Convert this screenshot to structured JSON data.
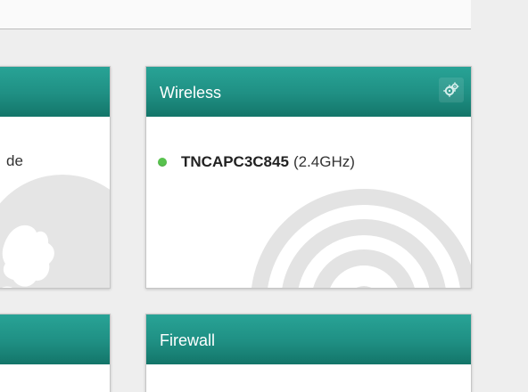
{
  "left_cards": {
    "top_partial_text": "de"
  },
  "wireless": {
    "title": "Wireless",
    "network": {
      "ssid": "TNCAPC3C845",
      "band": "(2.4GHz)",
      "status": "connected",
      "status_color": "#58c24e"
    },
    "settings_icon": "gears-icon",
    "background_icon": "wifi-signal-icon"
  },
  "firewall": {
    "title": "Firewall"
  },
  "theme": {
    "header_color": "#1f8f83",
    "card_background": "#ffffff",
    "page_background": "#eeeeee"
  }
}
